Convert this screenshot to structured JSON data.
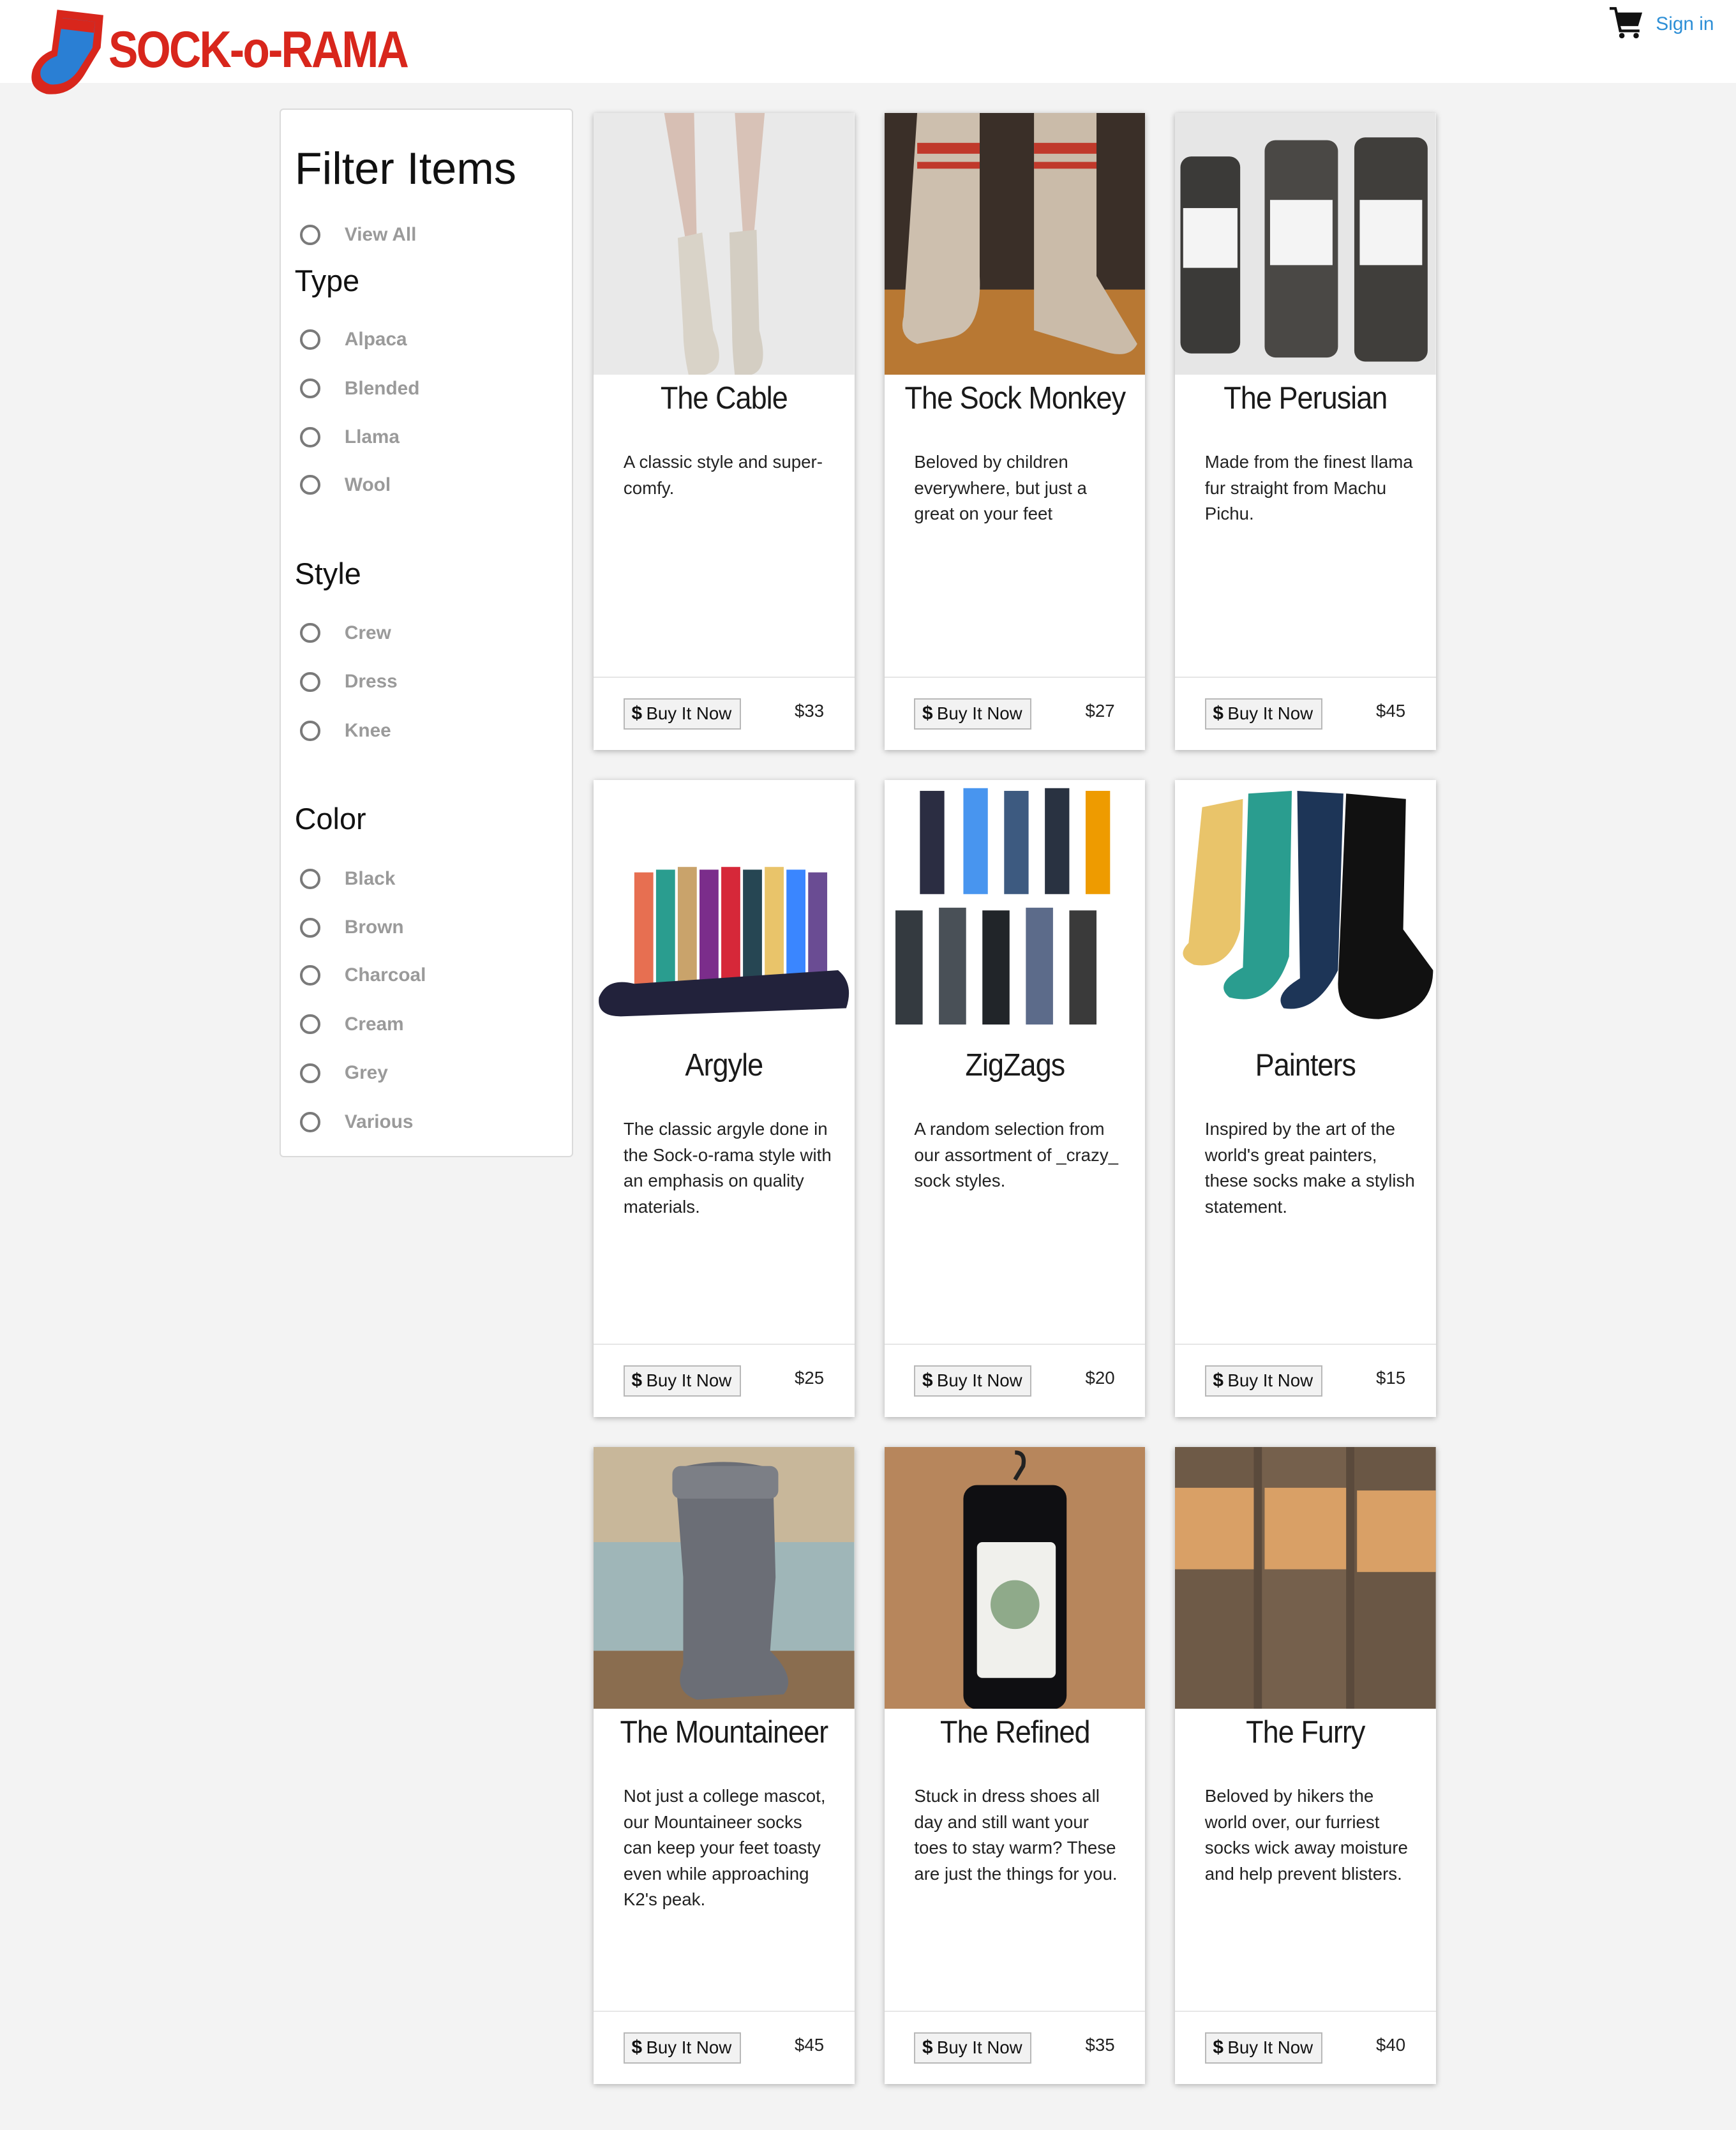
{
  "header": {
    "brand": "SOCK-o-RAMA",
    "cart_icon": "shopping-cart-icon",
    "signin_label": "Sign in"
  },
  "filter": {
    "title": "Filter Items",
    "view_all": "View All",
    "groups": [
      {
        "heading": "Type",
        "options": [
          "Alpaca",
          "Blended",
          "Llama",
          "Wool"
        ]
      },
      {
        "heading": "Style",
        "options": [
          "Crew",
          "Dress",
          "Knee"
        ]
      },
      {
        "heading": "Color",
        "options": [
          "Black",
          "Brown",
          "Charcoal",
          "Cream",
          "Grey",
          "Various"
        ]
      }
    ]
  },
  "buy_label": "Buy It Now",
  "buy_icon": "dollar-icon",
  "colors": {
    "brand_red": "#d8261c",
    "brand_blue": "#2a7fd4",
    "link": "#2e8fd6"
  },
  "products": [
    {
      "name": "The Cable",
      "description": "A classic style and super-comfy.",
      "price": "$33"
    },
    {
      "name": "The Sock Monkey",
      "description": "Beloved by children everywhere, but just a great on your feet",
      "price": "$27"
    },
    {
      "name": "The Perusian",
      "description": "Made from the finest llama fur straight from Machu Pichu.",
      "price": "$45"
    },
    {
      "name": "Argyle",
      "description": "The classic argyle done in the Sock-o-rama style with an emphasis on quality materials.",
      "price": "$25"
    },
    {
      "name": "ZigZags",
      "description": "A random selection from our assortment of _crazy_ sock styles.",
      "price": "$20"
    },
    {
      "name": "Painters",
      "description": "Inspired by the art of the world's great painters, these socks make a stylish statement.",
      "price": "$15"
    },
    {
      "name": "The Mountaineer",
      "description": "Not just a college mascot, our Mountaineer socks can keep your feet toasty even while approaching K2's peak.",
      "price": "$45"
    },
    {
      "name": "The Refined",
      "description": "Stuck in dress shoes all day and still want your toes to stay warm? These are just the things for you.",
      "price": "$35"
    },
    {
      "name": "The Furry",
      "description": "Beloved by hikers the world over, our furriest socks wick away moisture and help prevent blisters.",
      "price": "$40"
    }
  ]
}
